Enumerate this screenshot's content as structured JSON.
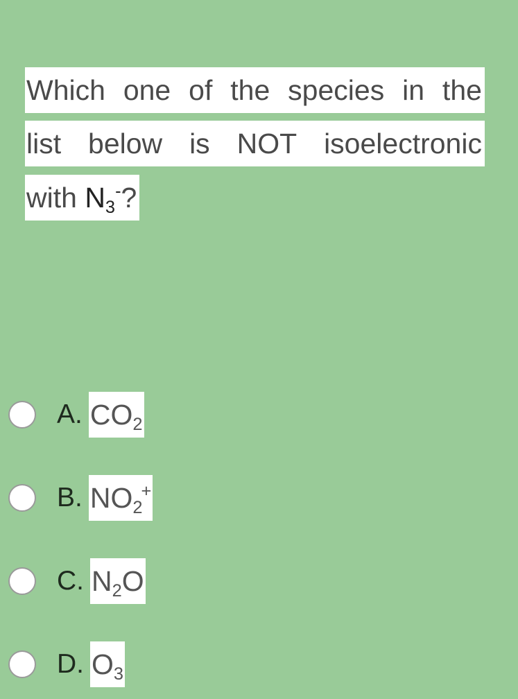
{
  "question": {
    "line1_words": [
      "Which",
      "one",
      "of",
      "the",
      "species",
      "in",
      "the"
    ],
    "line2_words": [
      "list",
      "below",
      "is",
      "NOT",
      "isoelectronic"
    ],
    "line3_prefix": "with ",
    "species": {
      "base": "N",
      "sub": "3",
      "sup": "-"
    },
    "line3_suffix": "?"
  },
  "options": [
    {
      "letter": "A.",
      "base": "CO",
      "sub": "2",
      "sup": "",
      "tail": "",
      "selected": false
    },
    {
      "letter": "B.",
      "base": "NO",
      "sub": "2",
      "sup": "+",
      "tail": "",
      "selected": false
    },
    {
      "letter": "C.",
      "base": "N",
      "sub": "2",
      "sup": "",
      "tail": "O",
      "selected": false
    },
    {
      "letter": "D.",
      "base": "O",
      "sub": "3",
      "sup": "",
      "tail": "",
      "selected": false
    }
  ],
  "colors": {
    "background": "#99cb98",
    "highlight": "#ffffff",
    "text": "#4a4a4a"
  }
}
